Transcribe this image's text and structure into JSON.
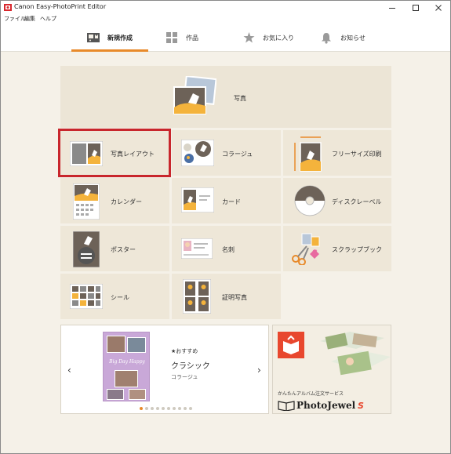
{
  "window": {
    "title": "Canon Easy-PhotoPrint Editor"
  },
  "menubar": {
    "items": [
      "ファイル",
      "編集",
      "ヘルプ"
    ]
  },
  "tabs": [
    {
      "label": "新規作成",
      "icon": "new-create-icon",
      "active": true
    },
    {
      "label": "作品",
      "icon": "grid-icon",
      "active": false
    },
    {
      "label": "お気に入り",
      "icon": "star-icon",
      "active": false
    },
    {
      "label": "お知らせ",
      "icon": "bell-icon",
      "active": false
    }
  ],
  "categories": {
    "photo": "写真",
    "photo_layout": "写真レイアウト",
    "collage": "コラージュ",
    "free_size": "フリーサイズ印刷",
    "calendar": "カレンダー",
    "card": "カード",
    "disc_label": "ディスクレーベル",
    "poster": "ポスター",
    "business_card": "名刺",
    "scrapbook": "スクラップブック",
    "sticker": "シール",
    "id_photo": "証明写真"
  },
  "featured": {
    "badge": "★おすすめ",
    "title": "クラシック",
    "subtitle": "コラージュ",
    "thumb_text": "Big Day Happy",
    "page_count": 10,
    "active_page": 1
  },
  "promo": {
    "tagline": "かんたんアルバム注文サービス",
    "brand": "PhotoJewel",
    "brand_suffix": "S"
  },
  "colors": {
    "accent": "#e88a2a",
    "selection": "#c8262c",
    "card_bg": "#eee7d8",
    "page_bg": "#f5f1e8"
  }
}
